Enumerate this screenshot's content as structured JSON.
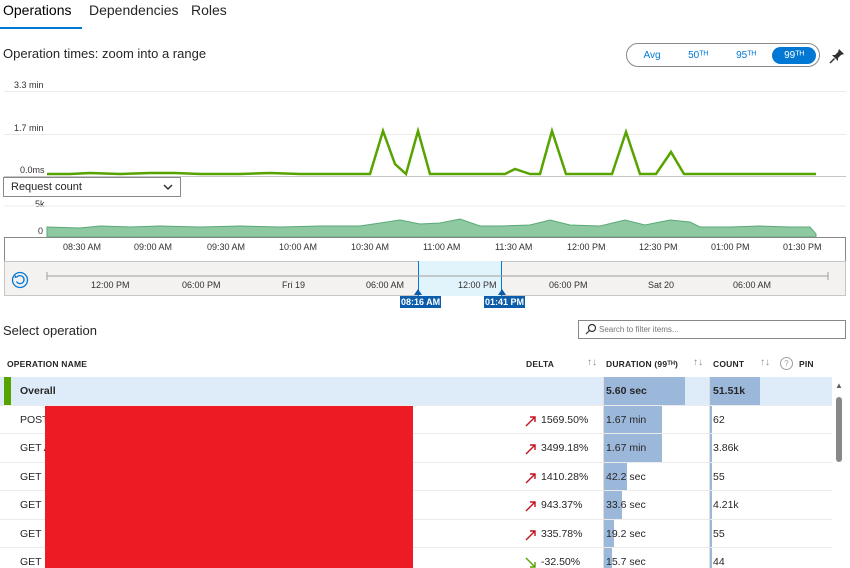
{
  "tabs": [
    "Operations",
    "Dependencies",
    "Roles"
  ],
  "chart_header": "Operation times: zoom into a range",
  "percentiles": {
    "options": [
      "Avg",
      "50ᵀᴴ",
      "95ᵀᴴ",
      "99ᵀᴴ"
    ],
    "selected": "99ᵀᴴ"
  },
  "icons": {
    "pin": "pin-icon",
    "reset": "reset-zoom-icon",
    "search": "search-icon",
    "chevron": "chevron-down-icon"
  },
  "colors": {
    "accent": "#0078d4",
    "duration_line": "#57a300",
    "request_area": "#8ec9a2",
    "bar": "#9bb7d9",
    "selection": "#e1f3fb",
    "redaction": "#ed1c24"
  },
  "duration_chart": {
    "y_labels": [
      "3.3 min",
      "1.7 min",
      "0.0ms"
    ],
    "points": [
      0.03,
      0.02,
      0.03,
      0.03,
      0.02,
      0.03,
      0.03,
      0.02,
      0.03,
      0.03,
      0.02,
      0.02,
      0.03,
      0.02,
      0.03,
      0.02,
      0.03,
      0.03,
      0.02,
      0.03,
      0.02,
      0.03,
      0.03,
      0.03,
      0.03,
      0.02,
      0.03,
      0.03,
      0.03,
      0.03,
      0.03,
      0.03,
      0.03,
      0.03,
      0.03,
      0.03,
      0.03,
      0.03,
      0.03,
      0.03,
      0.03,
      0.03,
      0.03,
      0.03,
      0.03,
      0.03,
      0.03,
      0.03,
      0.03,
      0.03,
      0.03,
      0.03,
      0.03,
      0.03,
      0.03,
      0.03,
      0.03,
      0.03,
      0.03,
      0.03,
      0.03,
      0.03,
      0.03,
      0.03,
      0.03,
      0.03,
      0.03,
      0.03,
      0.03,
      0.03,
      0.03,
      0.03,
      0.03,
      0.03,
      0.03,
      0.03,
      0.03,
      0.03,
      0.03,
      0.03,
      0.03,
      0.03,
      0.03,
      0.03,
      0.03,
      0.03,
      0.03,
      0.03,
      0.03,
      0.03
    ]
  },
  "request_select": {
    "value": "Request count"
  },
  "request_chart": {
    "y_labels": [
      "5k",
      "0"
    ],
    "x_labels": [
      "08:30 AM",
      "09:00 AM",
      "09:30 AM",
      "10:00 AM",
      "10:30 AM",
      "11:00 AM",
      "11:30 AM",
      "12:00 PM",
      "12:30 PM",
      "01:00 PM",
      "01:30 PM"
    ]
  },
  "brush": {
    "labels": [
      "12:00 PM",
      "06:00 PM",
      "Fri 19",
      "06:00 AM",
      "12:00 PM",
      "06:00 PM",
      "Sat 20",
      "06:00 AM"
    ],
    "start": "08:16 AM",
    "end": "01:41 PM"
  },
  "select_operation": "Select operation",
  "search": {
    "placeholder": "Search to filter items..."
  },
  "table": {
    "headers": {
      "name": "OPERATION NAME",
      "delta": "DELTA",
      "duration": "DURATION (99ᵀᴴ)",
      "count": "COUNT",
      "pin": "PIN"
    },
    "rows": [
      {
        "name": "Overall",
        "delta": "",
        "trend": "",
        "duration": "5.60 sec",
        "count": "51.51k",
        "dur_frac": 0.98,
        "cnt_frac": 0.42
      },
      {
        "name": "POST",
        "delta": "1569.50%",
        "trend": "up",
        "duration": "1.67 min",
        "count": "62",
        "dur_frac": 0.7,
        "cnt_frac": 0.0
      },
      {
        "name": "GET A",
        "delta": "3499.18%",
        "trend": "up",
        "duration": "1.67 min",
        "count": "3.86k",
        "dur_frac": 0.7,
        "cnt_frac": 0.02
      },
      {
        "name": "GET P",
        "delta": "1410.28%",
        "trend": "up",
        "duration": "42.2 sec",
        "count": "55",
        "dur_frac": 0.29,
        "cnt_frac": 0.0
      },
      {
        "name": "GET P",
        "delta": "943.37%",
        "trend": "up",
        "duration": "33.6 sec",
        "count": "4.21k",
        "dur_frac": 0.23,
        "cnt_frac": 0.02
      },
      {
        "name": "GET P",
        "delta": "335.78%",
        "trend": "up",
        "duration": "19.2 sec",
        "count": "55",
        "dur_frac": 0.13,
        "cnt_frac": 0.0
      },
      {
        "name": "GET F",
        "delta": "-32.50%",
        "trend": "down",
        "duration": "15.7 sec",
        "count": "44",
        "dur_frac": 0.11,
        "cnt_frac": 0.0
      }
    ]
  }
}
